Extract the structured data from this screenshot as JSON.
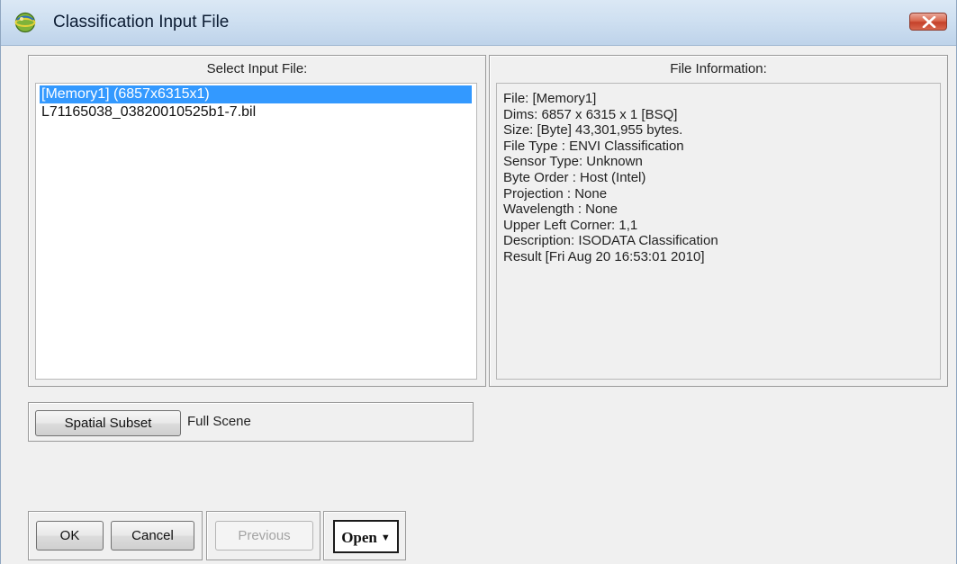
{
  "window": {
    "title": "Classification Input File"
  },
  "input_panel": {
    "header": "Select Input File:",
    "files": [
      {
        "label": "[Memory1] (6857x6315x1)",
        "selected": true
      },
      {
        "label": "L71165038_03820010525b1-7.bil",
        "selected": false
      }
    ]
  },
  "info_panel": {
    "header": "File Information:",
    "lines": [
      "File: [Memory1]",
      "Dims: 6857 x 6315 x 1 [BSQ]",
      "Size: [Byte] 43,301,955 bytes.",
      "File Type  : ENVI Classification",
      "Sensor Type: Unknown",
      "Byte Order : Host (Intel)",
      "Projection : None",
      "Wavelength : None",
      "Upper Left Corner: 1,1",
      "Description: ISODATA Classification",
      "Result [Fri Aug 20 16:53:01 2010]"
    ]
  },
  "subset": {
    "button_label": "Spatial Subset",
    "value": "Full Scene"
  },
  "buttons": {
    "ok": "OK",
    "cancel": "Cancel",
    "previous": "Previous",
    "open": "Open"
  },
  "icons": {
    "app": "envi-globe-icon",
    "close": "close-icon",
    "open_dropdown": "chevron-down-icon"
  },
  "colors": {
    "selection": "#3399ff",
    "close_button": "#d0563e",
    "disabled_text": "#a3a3a3"
  }
}
